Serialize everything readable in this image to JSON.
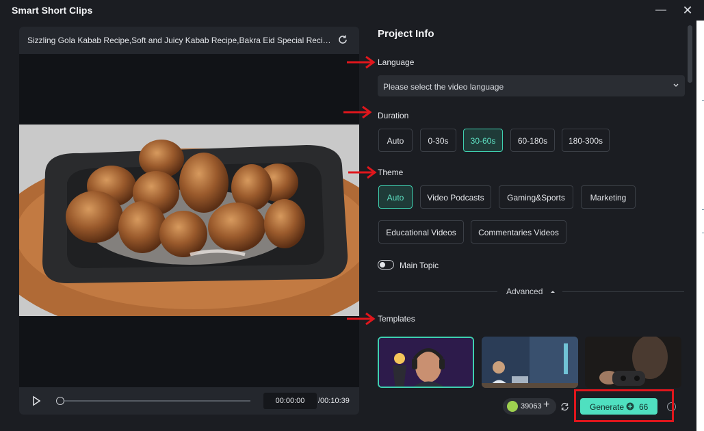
{
  "window": {
    "title": "Smart Short Clips",
    "minimize": "—",
    "close": "✕"
  },
  "preview": {
    "video_title": "Sizzling Gola Kabab Recipe,Soft and Juicy Kabab Recipe,Bakra Eid Special Recipe by...",
    "current_time": "00:00:00",
    "total_time": "/00:10:39",
    "progress": 0
  },
  "panel": {
    "title": "Project Info",
    "language": {
      "label": "Language",
      "placeholder": "Please select the video language"
    },
    "duration": {
      "label": "Duration",
      "options": [
        "Auto",
        "0-30s",
        "30-60s",
        "60-180s",
        "180-300s"
      ],
      "selected": "30-60s"
    },
    "theme": {
      "label": "Theme",
      "options": [
        "Auto",
        "Video Podcasts",
        "Gaming&Sports",
        "Marketing",
        "Educational Videos",
        "Commentaries Videos"
      ],
      "selected": "Auto"
    },
    "main_topic": {
      "label": "Main Topic",
      "enabled": false
    },
    "advanced": {
      "label": "Advanced",
      "icon": "caret-up-icon"
    },
    "templates": {
      "label": "Templates",
      "count_visible": 3,
      "selected_index": 0
    }
  },
  "footer": {
    "credits": "39063",
    "credits_plus": "+",
    "generate_label": "Generate",
    "generate_cost": "66"
  },
  "colors": {
    "accent": "#4fe0c0",
    "annotation": "#e0161c",
    "background": "#1b1d22"
  }
}
